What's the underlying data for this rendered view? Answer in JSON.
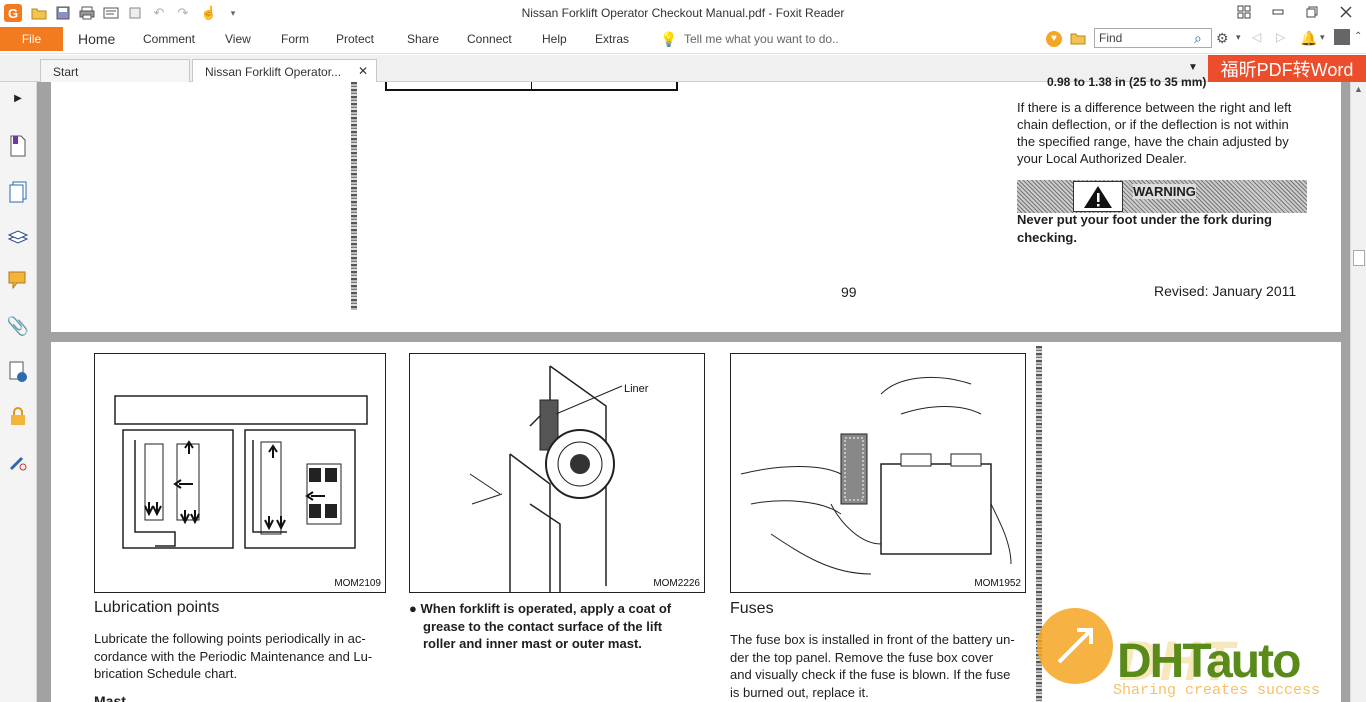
{
  "window": {
    "title": "Nissan Forklift Operator Checkout Manual.pdf - Foxit Reader"
  },
  "quick_access": {
    "icons": [
      "app-logo-icon",
      "open-icon",
      "save-icon",
      "print-icon",
      "properties-icon",
      "undo-icon",
      "redo-icon",
      "hand-tool-icon",
      "customize-dropdown-icon"
    ]
  },
  "menu": {
    "file": "File",
    "items": [
      "Home",
      "Comment",
      "View",
      "Form",
      "Protect",
      "Share",
      "Connect",
      "Help",
      "Extras"
    ],
    "tell_me": "Tell me what you want to do..",
    "find_placeholder": "Find"
  },
  "tabs": {
    "start": "Start",
    "active": "Nissan Forklift Operator...",
    "promo": "福昕PDF转Word"
  },
  "page1": {
    "top_cut": "0.98 to 1.38 in (25 to 35 mm)",
    "para": [
      "If there is a difference between the right and left",
      "chain deflection, or if the deflection is not within",
      "the specified range, have the chain adjusted by",
      "your Local Authorized Dealer."
    ],
    "warning_label": "WARNING",
    "warning_text": [
      "Never put your foot under the fork during",
      "checking."
    ],
    "page_number": "99",
    "revised": "Revised: January 2011"
  },
  "page2": {
    "fig1_code": "MOM2109",
    "fig2_code": "MOM2226",
    "fig2_label": "Liner",
    "fig3_code": "MOM1952",
    "heading1": "Lubrication points",
    "para1": [
      "Lubricate the following points periodically in ac-",
      "cordance with the Periodic Maintenance and Lu-",
      "brication Schedule chart."
    ],
    "bullet": [
      "When forklift is operated, apply a coat of",
      "grease to the contact surface of the lift",
      "roller and inner mast or outer mast."
    ],
    "heading3": "Fuses",
    "para3": [
      "The fuse box is installed in front of the battery un-",
      "der the top panel. Remove the fuse box cover",
      "and visually check if the fuse is blown. If the fuse",
      "is burned out, replace it."
    ],
    "cut_bottom": "Mast"
  },
  "watermark": {
    "brand": "DHTauto",
    "slogan": "Sharing creates success"
  },
  "colors": {
    "file_tab": "#f47a20",
    "promo": "#ec4e2b",
    "watermark_orange": "#f5a623",
    "watermark_green": "#5a8a1a"
  }
}
